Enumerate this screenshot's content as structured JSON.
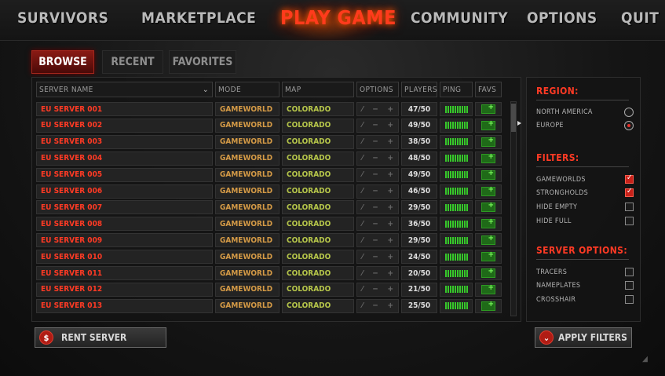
{
  "nav": {
    "items": [
      "SURVIVORS",
      "MARKETPLACE",
      "PLAY GAME",
      "COMMUNITY",
      "OPTIONS",
      "QUIT"
    ],
    "active": "PLAY GAME"
  },
  "tabs": [
    "BROWSE",
    "RECENT",
    "FAVORITES"
  ],
  "table": {
    "headers": {
      "server_name": "SERVER NAME",
      "mode": "MODE",
      "map": "MAP",
      "options": "OPTIONS",
      "players": "PLAYERS",
      "ping": "PING",
      "favs": "FAVS"
    },
    "rows": [
      {
        "name": "EU SERVER 001",
        "mode": "GAMEWORLD",
        "map": "COLORADO",
        "players": "47/50"
      },
      {
        "name": "EU SERVER 002",
        "mode": "GAMEWORLD",
        "map": "COLORADO",
        "players": "49/50"
      },
      {
        "name": "EU SERVER 003",
        "mode": "GAMEWORLD",
        "map": "COLORADO",
        "players": "38/50"
      },
      {
        "name": "EU SERVER 004",
        "mode": "GAMEWORLD",
        "map": "COLORADO",
        "players": "48/50"
      },
      {
        "name": "EU SERVER 005",
        "mode": "GAMEWORLD",
        "map": "COLORADO",
        "players": "49/50"
      },
      {
        "name": "EU SERVER 006",
        "mode": "GAMEWORLD",
        "map": "COLORADO",
        "players": "46/50"
      },
      {
        "name": "EU SERVER 007",
        "mode": "GAMEWORLD",
        "map": "COLORADO",
        "players": "29/50"
      },
      {
        "name": "EU SERVER 008",
        "mode": "GAMEWORLD",
        "map": "COLORADO",
        "players": "36/50"
      },
      {
        "name": "EU SERVER 009",
        "mode": "GAMEWORLD",
        "map": "COLORADO",
        "players": "29/50"
      },
      {
        "name": "EU SERVER 010",
        "mode": "GAMEWORLD",
        "map": "COLORADO",
        "players": "24/50"
      },
      {
        "name": "EU SERVER 011",
        "mode": "GAMEWORLD",
        "map": "COLORADO",
        "players": "20/50"
      },
      {
        "name": "EU SERVER 012",
        "mode": "GAMEWORLD",
        "map": "COLORADO",
        "players": "21/50"
      },
      {
        "name": "EU SERVER 013",
        "mode": "GAMEWORLD",
        "map": "COLORADO",
        "players": "25/50"
      }
    ]
  },
  "buttons": {
    "rent_server": "RENT SERVER",
    "apply_filters": "APPLY FILTERS"
  },
  "filters": {
    "region_title": "REGION:",
    "regions": [
      {
        "label": "NORTH AMERICA",
        "selected": false
      },
      {
        "label": "EUROPE",
        "selected": true
      }
    ],
    "filters_title": "FILTERS:",
    "filter_items": [
      {
        "label": "GAMEWORLDS",
        "checked": true
      },
      {
        "label": "STRONGHOLDS",
        "checked": true
      },
      {
        "label": "HIDE EMPTY",
        "checked": false
      },
      {
        "label": "HIDE FULL",
        "checked": false
      }
    ],
    "server_options_title": "SERVER OPTIONS:",
    "server_options": [
      {
        "label": "TRACERS",
        "checked": false
      },
      {
        "label": "NAMEPLATES",
        "checked": false
      },
      {
        "label": "CROSSHAIR",
        "checked": false
      }
    ]
  },
  "colors": {
    "accent_red": "#ff3a24",
    "mode_orange": "#d49a46",
    "map_green": "#b6c64a",
    "ping_green": "#36c82a"
  }
}
